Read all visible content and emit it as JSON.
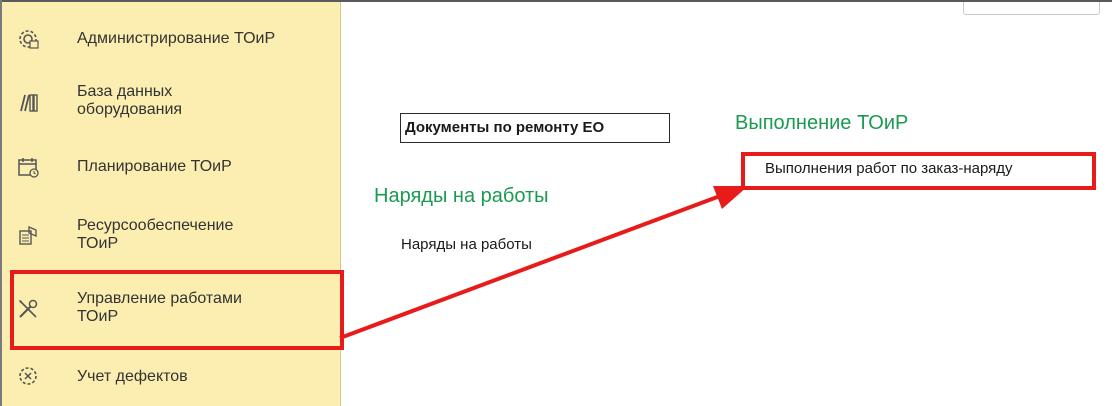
{
  "sidebar": {
    "items": [
      {
        "label": "Администрирование ТОиР",
        "icon": "gear-settings-icon"
      },
      {
        "label": "База данных\nоборудования",
        "icon": "books-icon"
      },
      {
        "label": "Планирование ТОиР",
        "icon": "calendar-icon"
      },
      {
        "label": "Ресурсообеспечение\nТОиР",
        "icon": "resources-icon"
      },
      {
        "label": "Управление работами\nТОиР",
        "icon": "wrench-screwdriver-icon"
      },
      {
        "label": "Учет дефектов",
        "icon": "defect-icon"
      }
    ]
  },
  "main": {
    "documents_label": "Документы по ремонту ЕО",
    "orders_section": {
      "title": "Наряды на работы",
      "link": "Наряды на работы"
    },
    "execution_section": {
      "title": "Выполнение ТОиР",
      "link": "Выполнения работ по заказ-наряду"
    }
  },
  "colors": {
    "sidebar_bg": "#fbeeb0",
    "section_title": "#1b9a52",
    "highlight": "#e81b1b"
  }
}
